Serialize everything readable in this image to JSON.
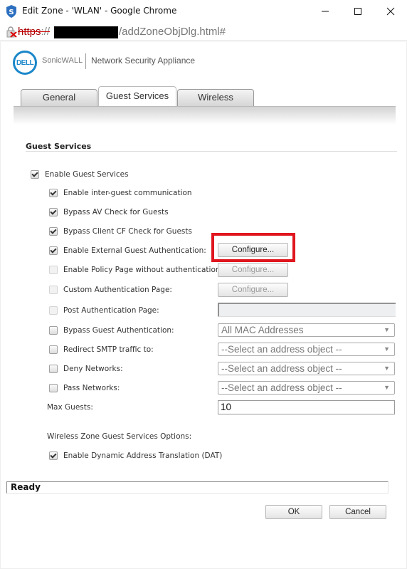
{
  "window": {
    "title": "Edit Zone - 'WLAN' - Google Chrome",
    "minimize": "minimize",
    "maximize": "maximize",
    "close": "close"
  },
  "address_bar": {
    "scheme": "https",
    "separator": "://",
    "path": "/addZoneObjDlg.html#",
    "security": "not-secure"
  },
  "header": {
    "logo": "DELL",
    "brand": "SonicWALL",
    "product": "Network Security Appliance"
  },
  "tabs": [
    {
      "label": "General",
      "active": false
    },
    {
      "label": "Guest Services",
      "active": true
    },
    {
      "label": "Wireless",
      "active": false
    }
  ],
  "section": {
    "title": "Guest Services"
  },
  "options": {
    "enable_guest_services": {
      "label": "Enable Guest Services",
      "checked": true
    },
    "inter_guest": {
      "label": "Enable inter-guest communication",
      "checked": true
    },
    "bypass_av": {
      "label": "Bypass AV Check for Guests",
      "checked": true
    },
    "bypass_cf": {
      "label": "Bypass Client CF Check for Guests",
      "checked": true
    },
    "external_auth": {
      "label": "Enable External Guest Authentication:",
      "checked": true,
      "button": "Configure..."
    },
    "policy_page": {
      "label": "Enable Policy Page without authentication:",
      "checked": false,
      "disabled": true,
      "button": "Configure..."
    },
    "custom_auth": {
      "label": "Custom Authentication Page:",
      "checked": false,
      "disabled": true,
      "button": "Configure..."
    },
    "post_auth": {
      "label": "Post Authentication Page:",
      "checked": false,
      "disabled": true,
      "value": ""
    },
    "bypass_guest_auth": {
      "label": "Bypass Guest Authentication:",
      "checked": false,
      "select": "All MAC Addresses"
    },
    "redirect_smtp": {
      "label": "Redirect SMTP traffic to:",
      "checked": false,
      "select": "--Select an address object --"
    },
    "deny_networks": {
      "label": "Deny Networks:",
      "checked": false,
      "select": "--Select an address object --"
    },
    "pass_networks": {
      "label": "Pass Networks:",
      "checked": false,
      "select": "--Select an address object --"
    },
    "max_guests": {
      "label": "Max Guests:",
      "value": "10"
    }
  },
  "wireless_options": {
    "heading": "Wireless Zone Guest Services Options:",
    "dat": {
      "label": "Enable Dynamic Address Translation (DAT)",
      "checked": true
    }
  },
  "status": "Ready",
  "footer": {
    "ok": "OK",
    "cancel": "Cancel"
  },
  "colors": {
    "highlight": "#e0161f",
    "dell_blue": "#1a87c9"
  }
}
